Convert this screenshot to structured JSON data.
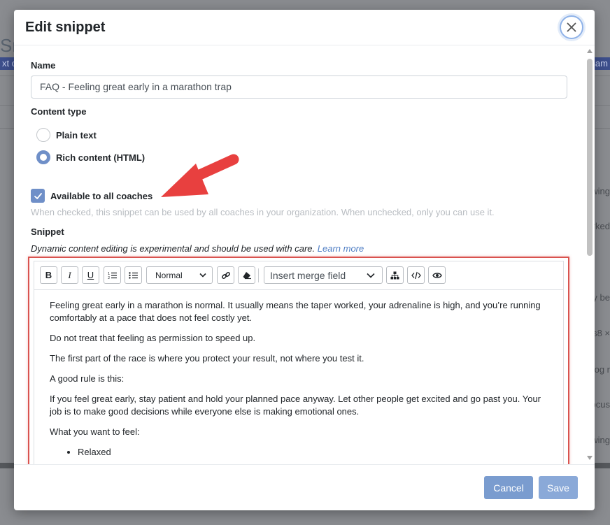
{
  "background": {
    "title_fragment": "Sn",
    "tag_left": "xt o",
    "tag_right": "nam",
    "right_fragments": [
      "wing",
      "rked",
      "y be",
      "s8 ×",
      "og r",
      "ocus",
      "wing"
    ]
  },
  "modal": {
    "title": "Edit snippet",
    "close_icon": "close-icon",
    "name_label": "Name",
    "name_value": "FAQ - Feeling great early in a marathon trap",
    "content_type_label": "Content type",
    "radio_options": [
      {
        "label": "Plain text",
        "checked": false
      },
      {
        "label": "Rich content (HTML)",
        "checked": true
      }
    ],
    "checkbox_label": "Available to all coaches",
    "checkbox_checked": true,
    "checkbox_help": "When checked, this snippet can be used by all coaches in your organization. When unchecked, only you can use it.",
    "snippet_label": "Snippet",
    "snippet_note": "Dynamic content editing is experimental and should be used with care.",
    "learn_more": "Learn more",
    "toolbar": {
      "bold": "B",
      "italic": "I",
      "underline": "U",
      "format_value": "Normal",
      "merge_field_placeholder": "Insert merge field"
    },
    "editor_paragraphs": [
      "Feeling great early in a marathon is normal. It usually means the taper worked, your adrenaline is high, and you’re running comfortably at a pace that does not feel costly yet.",
      "Do not treat that feeling as permission to speed up.",
      "The first part of the race is where you protect your result, not where you test it.",
      "A good rule is this:",
      "If you feel great early, stay patient and hold your planned pace anyway. Let other people get excited and go past you. Your job is to make good decisions while everyone else is making emotional ones.",
      "What you want to feel:"
    ],
    "editor_list": [
      "Relaxed"
    ],
    "cancel_label": "Cancel",
    "save_label": "Save"
  },
  "colors": {
    "accent": "#6f8fc8",
    "highlight_border": "#d9534f",
    "annotation_arrow": "#e8403f"
  }
}
